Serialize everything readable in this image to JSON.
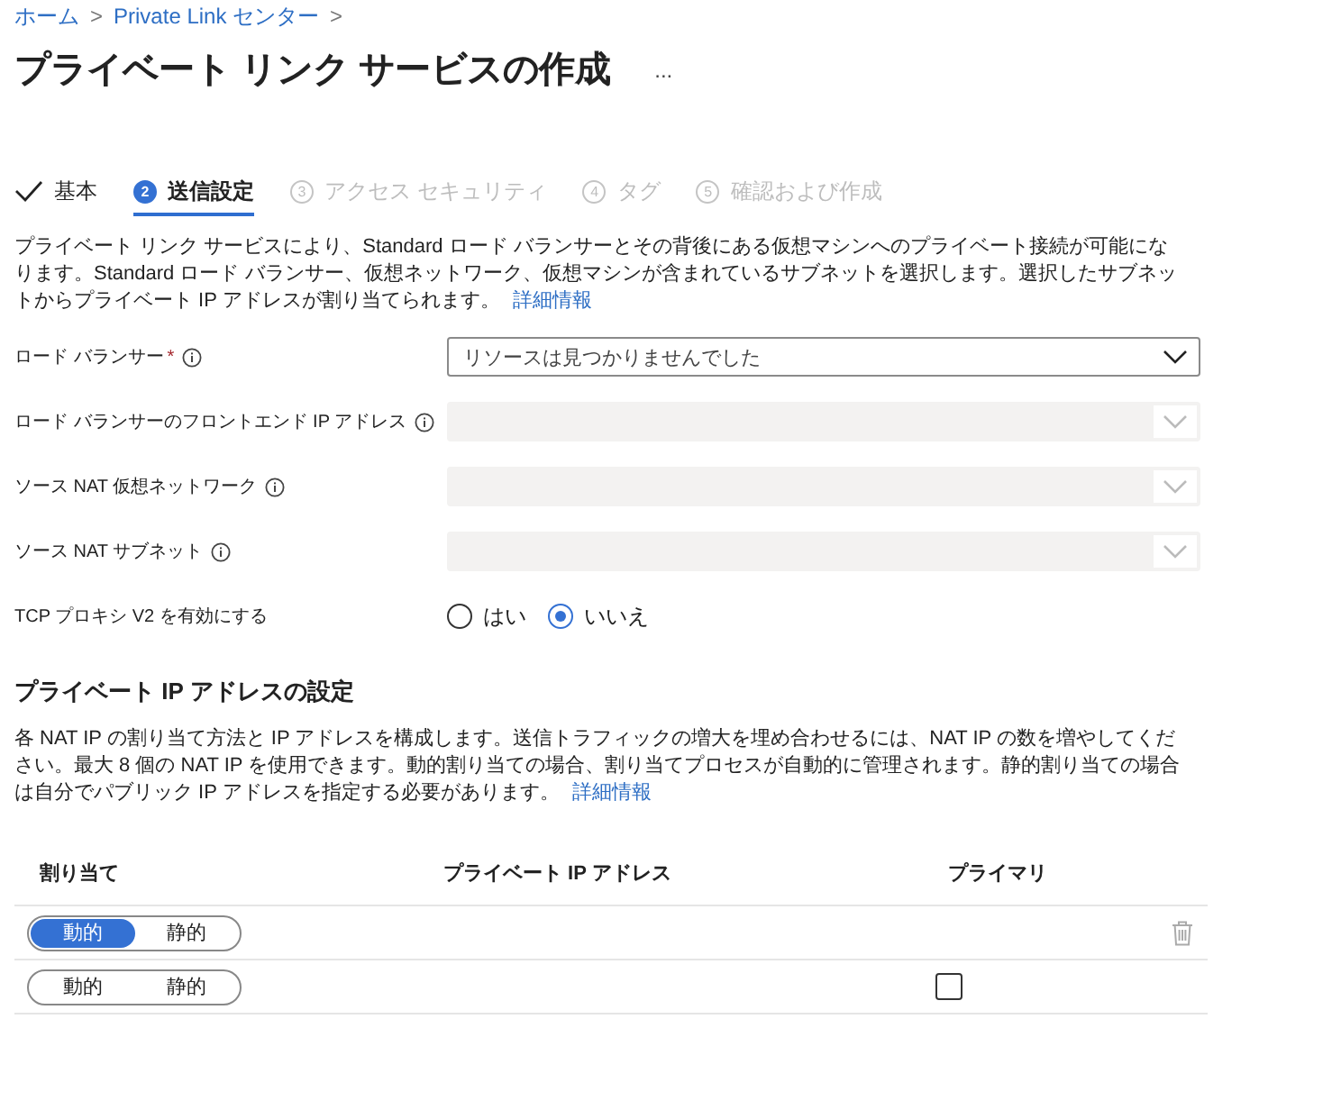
{
  "breadcrumb": [
    {
      "label": "ホーム"
    },
    {
      "label": "Private Link センター"
    }
  ],
  "breadcrumb_separator": ">",
  "title": "プライベート リンク サービスの作成",
  "more": "...",
  "steps": [
    {
      "label": "基本",
      "kind": "done",
      "selected": false
    },
    {
      "number": "2",
      "label": "送信設定",
      "kind": "current",
      "selected": true
    },
    {
      "number": "3",
      "label": "アクセス セキュリティ",
      "kind": "pending",
      "selected": false
    },
    {
      "number": "4",
      "label": "タグ",
      "kind": "pending",
      "selected": false
    },
    {
      "number": "5",
      "label": "確認および作成",
      "kind": "pending",
      "selected": false
    }
  ],
  "description": {
    "text": "プライベート リンク サービスにより、Standard ロード バランサーとその背後にある仮想マシンへのプライベート接続が可能になります。Standard ロード バランサー、仮想ネットワーク、仮想マシンが含まれているサブネットを選択します。選択したサブネットからプライベート IP アドレスが割り当てられます。",
    "link": "詳細情報"
  },
  "fields": [
    {
      "kind": "dropdown",
      "label": "ロード バランサー",
      "required": true,
      "required_mark": "*",
      "info": true,
      "value": "リソースは見つかりませんでした",
      "disabled": false
    },
    {
      "kind": "dropdown",
      "label": "ロード バランサーのフロントエンド IP アドレス",
      "required": false,
      "info": true,
      "disabled": true
    },
    {
      "kind": "dropdown",
      "label": "ソース NAT 仮想ネットワーク",
      "required": false,
      "info": true,
      "disabled": true
    },
    {
      "kind": "dropdown",
      "label": "ソース NAT サブネット",
      "required": false,
      "info": true,
      "disabled": true
    },
    {
      "kind": "radio",
      "label": "TCP プロキシ V2 を有効にする",
      "required": false,
      "info": false,
      "options": [
        {
          "label": "はい",
          "selected": false
        },
        {
          "label": "いいえ",
          "selected": true
        }
      ]
    }
  ],
  "ip_section": {
    "heading": "プライベート IP アドレスの設定",
    "text": "各 NAT IP の割り当て方法と IP アドレスを構成します。送信トラフィックの増大を埋め合わせるには、NAT IP の数を増やしてください。最大 8 個の NAT IP を使用できます。動的割り当ての場合、割り当てプロセスが自動的に管理されます。静的割り当ての場合は自分でパブリック IP アドレスを指定する必要があります。",
    "link": "詳細情報"
  },
  "table": {
    "columns": [
      "割り当て",
      "プライベート IP アドレス",
      "プライマリ"
    ],
    "rows": [
      {
        "allocation": [
          {
            "label": "動的",
            "selected": true
          },
          {
            "label": "静的",
            "selected": false
          }
        ],
        "deletable": true
      },
      {
        "allocation": [
          {
            "label": "動的",
            "selected": false
          },
          {
            "label": "静的",
            "selected": false
          }
        ],
        "primary": {
          "checked": false
        },
        "deletable": false
      }
    ]
  }
}
